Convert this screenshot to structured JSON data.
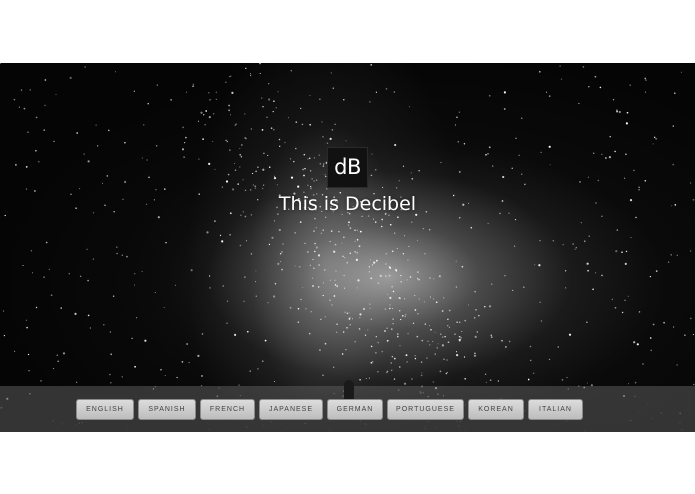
{
  "logo": {
    "text": "dB"
  },
  "hero": {
    "title": "This is Decibel"
  },
  "languages": [
    "ENGLISH",
    "SPANISH",
    "FRENCH",
    "JAPANESE",
    "GERMAN",
    "PORTUGUESE",
    "KOREAN",
    "ITALIAN"
  ],
  "colors": {
    "page_background": "#ffffff",
    "hero_background": "#050505",
    "logo_background": "#111111",
    "title_text": "#ffffff",
    "button_background": "#cfcfcf",
    "button_text": "#444444"
  }
}
